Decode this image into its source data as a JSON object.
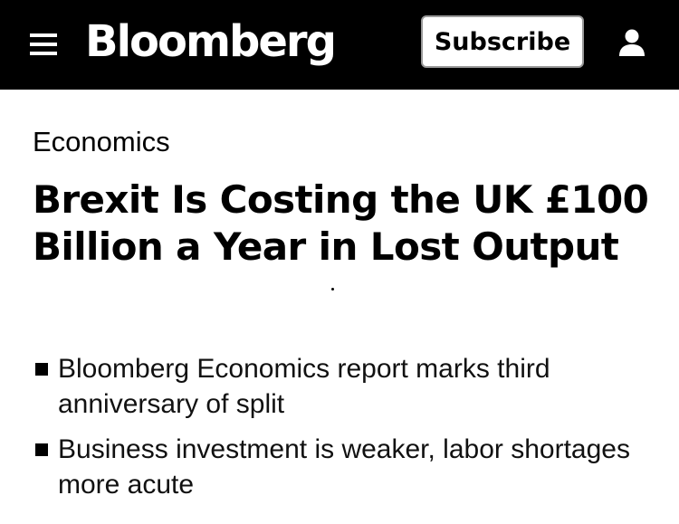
{
  "header": {
    "logo": "Bloomberg",
    "subscribe_label": "Subscribe",
    "menu_icon": "hamburger-menu-icon",
    "user_icon": "user-account-icon",
    "background_color": "#000000"
  },
  "article": {
    "category": "Economics",
    "headline": "Brexit Is Costing the UK £100 Billion a Year in Lost Output",
    "bullets": [
      {
        "text": "Bloomberg Economics report marks third anniversary of split"
      },
      {
        "text": "Business investment is weaker, labor shortages more acute"
      }
    ]
  }
}
